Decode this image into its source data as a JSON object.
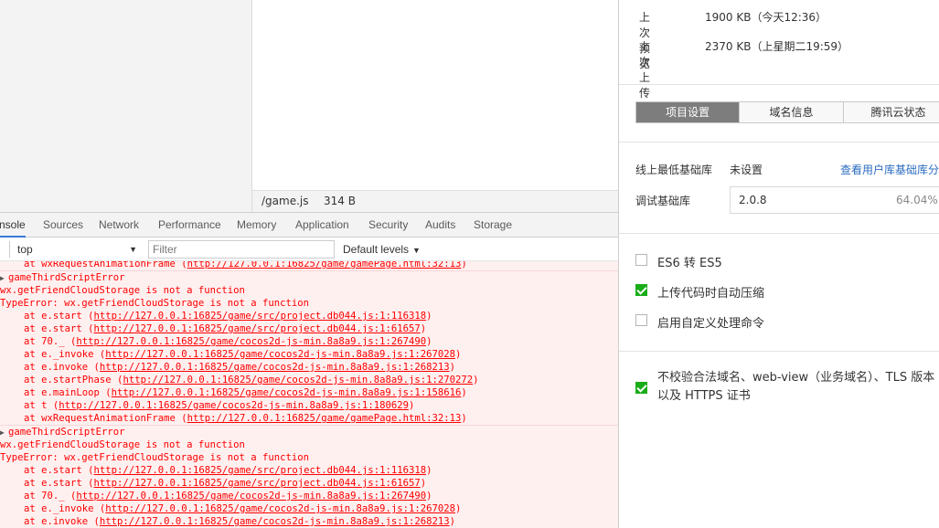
{
  "left": {
    "file": {
      "name": "/game.js",
      "size": "314 B"
    },
    "devtools_tabs": [
      "nsole",
      "Sources",
      "Network",
      "Performance",
      "Memory",
      "Application",
      "Security",
      "Audits",
      "Storage"
    ],
    "toolbar": {
      "context": "top",
      "filter_placeholder": "Filter",
      "levels": "Default levels"
    },
    "console": {
      "partial_line_prefix": "at wxRequestAnimationFrame (",
      "partial_line_url": "http://127.0.0.1:16825/game/gamePage.html:32:13",
      "errors": [
        {
          "header": "gameThirdScriptError",
          "message": "wx.getFriendCloudStorage is not a function",
          "type_line": "TypeError: wx.getFriendCloudStorage is not a function",
          "frames": [
            {
              "fn": "at e.start (",
              "url": "http://127.0.0.1:16825/game/src/project.db044.js:1:116318"
            },
            {
              "fn": "at e.start (",
              "url": "http://127.0.0.1:16825/game/src/project.db044.js:1:61657"
            },
            {
              "fn": "at 70._ (",
              "url": "http://127.0.0.1:16825/game/cocos2d-js-min.8a8a9.js:1:267490"
            },
            {
              "fn": "at e._invoke (",
              "url": "http://127.0.0.1:16825/game/cocos2d-js-min.8a8a9.js:1:267028"
            },
            {
              "fn": "at e.invoke (",
              "url": "http://127.0.0.1:16825/game/cocos2d-js-min.8a8a9.js:1:268213"
            },
            {
              "fn": "at e.startPhase (",
              "url": "http://127.0.0.1:16825/game/cocos2d-js-min.8a8a9.js:1:270272"
            },
            {
              "fn": "at e.mainLoop (",
              "url": "http://127.0.0.1:16825/game/cocos2d-js-min.8a8a9.js:1:158616"
            },
            {
              "fn": "at t (",
              "url": "http://127.0.0.1:16825/game/cocos2d-js-min.8a8a9.js:1:180629"
            },
            {
              "fn": "at wxRequestAnimationFrame (",
              "url": "http://127.0.0.1:16825/game/gamePage.html:32:13"
            }
          ]
        },
        {
          "header": "gameThirdScriptError",
          "message": "wx.getFriendCloudStorage is not a function",
          "type_line": "TypeError: wx.getFriendCloudStorage is not a function",
          "frames": [
            {
              "fn": "at e.start (",
              "url": "http://127.0.0.1:16825/game/src/project.db044.js:1:116318"
            },
            {
              "fn": "at e.start (",
              "url": "http://127.0.0.1:16825/game/src/project.db044.js:1:61657"
            },
            {
              "fn": "at 70._ (",
              "url": "http://127.0.0.1:16825/game/cocos2d-js-min.8a8a9.js:1:267490"
            },
            {
              "fn": "at e._invoke (",
              "url": "http://127.0.0.1:16825/game/cocos2d-js-min.8a8a9.js:1:267028"
            },
            {
              "fn": "at e.invoke (",
              "url": "http://127.0.0.1:16825/game/cocos2d-js-min.8a8a9.js:1:268213"
            }
          ]
        }
      ]
    }
  },
  "right": {
    "info": [
      {
        "key": "上次预览",
        "value": "1900 KB（今天12:36）"
      },
      {
        "key": "上次上传",
        "value": "2370 KB（上星期二19:59）"
      }
    ],
    "tabs": [
      "项目设置",
      "域名信息",
      "腾讯云状态"
    ],
    "min_lib_label": "线上最低基础库",
    "min_lib_value": "未设置",
    "min_lib_link": "查看用户库基础库分布",
    "debug_lib_label": "调试基础库",
    "debug_lib_version": "2.0.8",
    "debug_lib_percent": "64.04%",
    "options": [
      {
        "label": "ES6 转 ES5",
        "checked": false
      },
      {
        "label": "上传代码时自动压缩",
        "checked": true
      },
      {
        "label": "启用自定义处理命令",
        "checked": false
      }
    ],
    "domain_option": {
      "label": "不校验合法域名、web-view（业务域名）、TLS 版本以及 HTTPS 证书",
      "checked": true
    }
  },
  "colors": {
    "error_text": "#ff0000",
    "error_bg": "#fff0f0",
    "active_tab_underline": "#3879d9",
    "segment_active_bg": "#7d7d7d",
    "checkbox_on": "#1aad19",
    "link": "#2a6bbf"
  }
}
